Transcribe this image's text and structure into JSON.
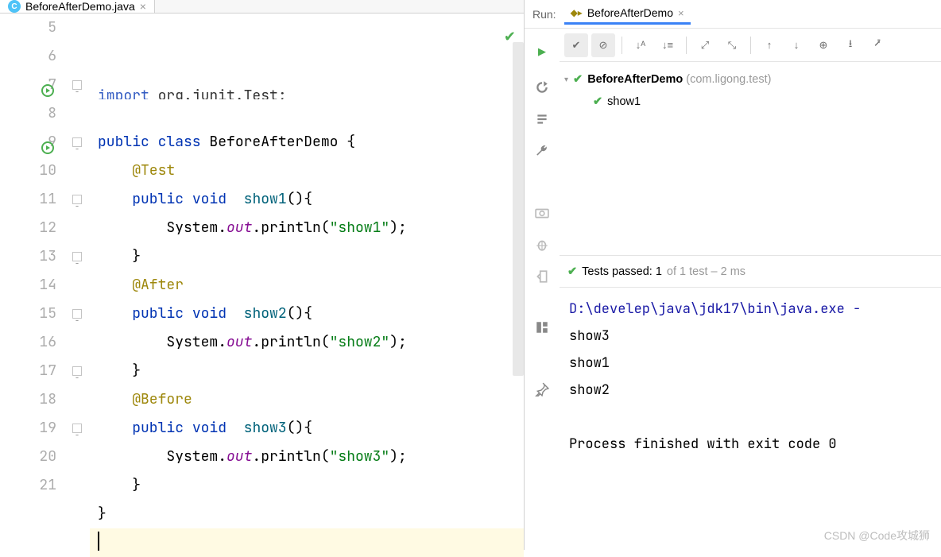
{
  "editor": {
    "tab": {
      "filename": "BeforeAfterDemo.java"
    },
    "lines": [
      {
        "n": 5,
        "html": "<span class='kw'>import</span> org.junit.<span class='cls'>Test</span>;",
        "cutoff": true
      },
      {
        "n": 6,
        "html": ""
      },
      {
        "n": 7,
        "html": "<span class='kw'>public class</span> <span class='cls'>BeforeAfterDemo</span> {",
        "run": true,
        "fold": true
      },
      {
        "n": 8,
        "html": "    <span class='ann'>@Test</span>"
      },
      {
        "n": 9,
        "html": "    <span class='kw'>public</span> <span class='kw'>void</span>  <span class='mtd'>show1</span>(){",
        "run": true,
        "fold": true
      },
      {
        "n": 10,
        "html": "        System.<span class='fld-it'>out</span>.println(<span class='str'>\"show1\"</span>);"
      },
      {
        "n": 11,
        "html": "    }",
        "fold": true
      },
      {
        "n": 12,
        "html": "    <span class='ann'>@After</span>"
      },
      {
        "n": 13,
        "html": "    <span class='kw'>public</span> <span class='kw'>void</span>  <span class='mtd'>show2</span>(){",
        "fold": true
      },
      {
        "n": 14,
        "html": "        System.<span class='fld-it'>out</span>.println(<span class='str'>\"show2\"</span>);"
      },
      {
        "n": 15,
        "html": "    }",
        "fold": true
      },
      {
        "n": 16,
        "html": "    <span class='ann'>@Before</span>"
      },
      {
        "n": 17,
        "html": "    <span class='kw'>public</span> <span class='kw'>void</span>  <span class='mtd'>show3</span>(){",
        "fold": true
      },
      {
        "n": 18,
        "html": "        System.<span class='fld-it'>out</span>.println(<span class='str'>\"show3\"</span>);"
      },
      {
        "n": 19,
        "html": "    }",
        "fold": true
      },
      {
        "n": 20,
        "html": "}"
      },
      {
        "n": 21,
        "html": "<span class='caret'></span>",
        "cursor": true
      }
    ]
  },
  "run": {
    "label": "Run:",
    "tab_name": "BeforeAfterDemo",
    "tree": {
      "root_name": "BeforeAfterDemo",
      "root_pkg": "(com.ligong.test)",
      "child": "show1"
    },
    "status": {
      "passed": "Tests passed: 1",
      "of": " of 1 test – 2 ms"
    },
    "console": {
      "path": "D:\\develep\\java\\jdk17\\bin\\java.exe ",
      "lines": [
        "show3",
        "show1",
        "show2"
      ],
      "exit": "Process finished with exit code 0"
    }
  },
  "watermark": "CSDN @Code攻城狮"
}
